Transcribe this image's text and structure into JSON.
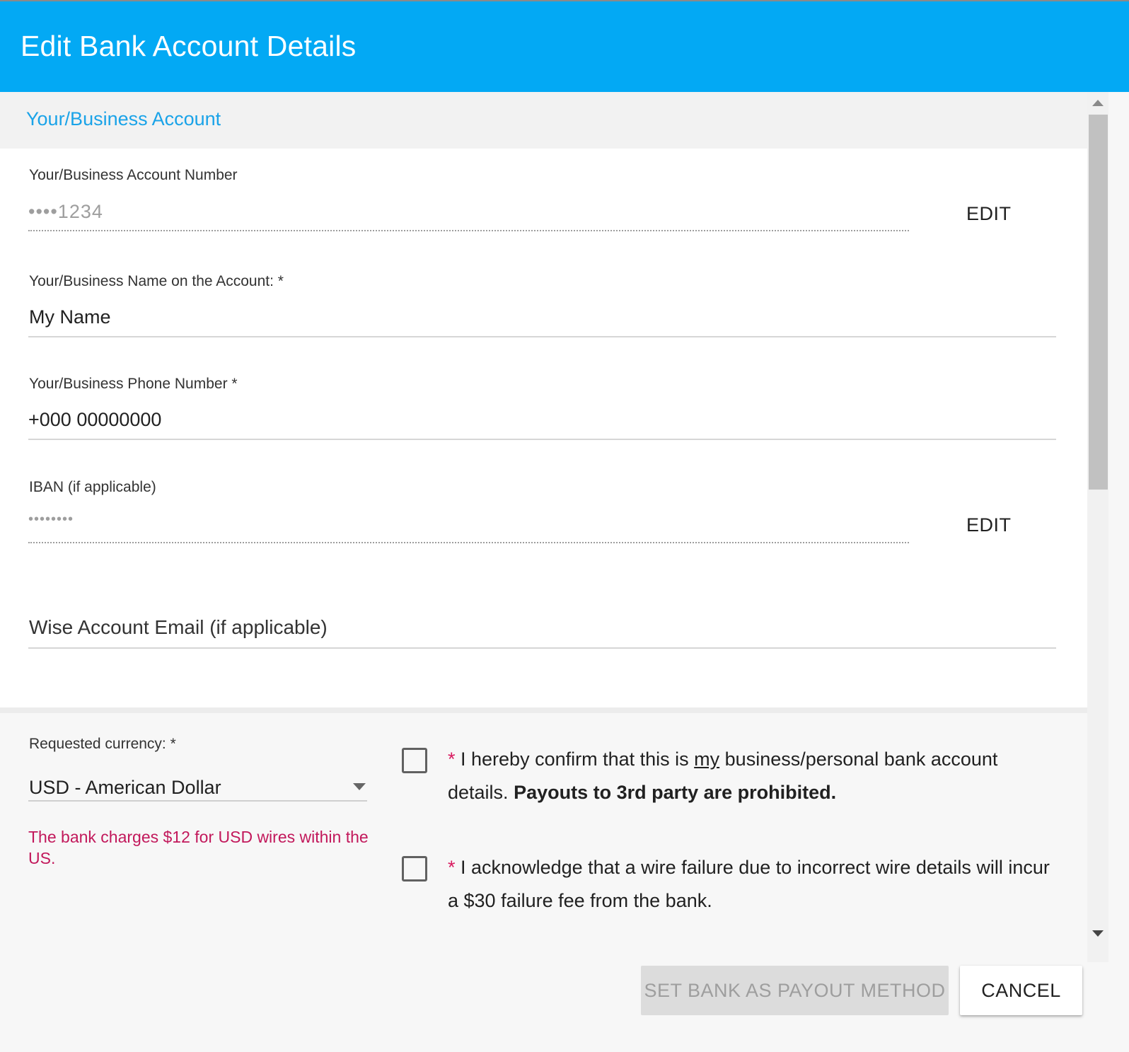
{
  "header": {
    "title": "Edit Bank Account Details"
  },
  "section": {
    "title": "Your/Business Account"
  },
  "fields": {
    "account_number": {
      "label": "Your/Business Account Number",
      "value": "••••1234",
      "action": "EDIT"
    },
    "name_on_account": {
      "label": "Your/Business Name on the Account: *",
      "value": "My Name"
    },
    "phone_number": {
      "label": "Your/Business Phone Number *",
      "value": "+000 00000000"
    },
    "iban": {
      "label": "IBAN (if applicable)",
      "value": "••••••••",
      "action": "EDIT"
    },
    "wise_email": {
      "placeholder": "Wise Account Email (if applicable)"
    }
  },
  "currency": {
    "label": "Requested currency: *",
    "selected": "USD - American Dollar",
    "warning": "The bank charges $12 for USD wires within the US."
  },
  "confirmations": {
    "confirm_own_account": {
      "star": "*",
      "text_before": " I hereby confirm that this is ",
      "underlined": "my",
      "text_after": " business/personal bank account details. ",
      "bold": "Payouts to 3rd party are prohibited."
    },
    "acknowledge_fee": {
      "star": "*",
      "text": " I acknowledge that a wire failure due to incorrect wire details will incur a $30 failure fee from the bank."
    }
  },
  "footer": {
    "primary_label": "SET BANK AS PAYOUT METHOD",
    "cancel_label": "CANCEL"
  },
  "colors": {
    "header_bg": "#03a9f4",
    "section_title": "#1aa3e8",
    "required_star": "#d81b60",
    "warning_text": "#c2185b"
  }
}
